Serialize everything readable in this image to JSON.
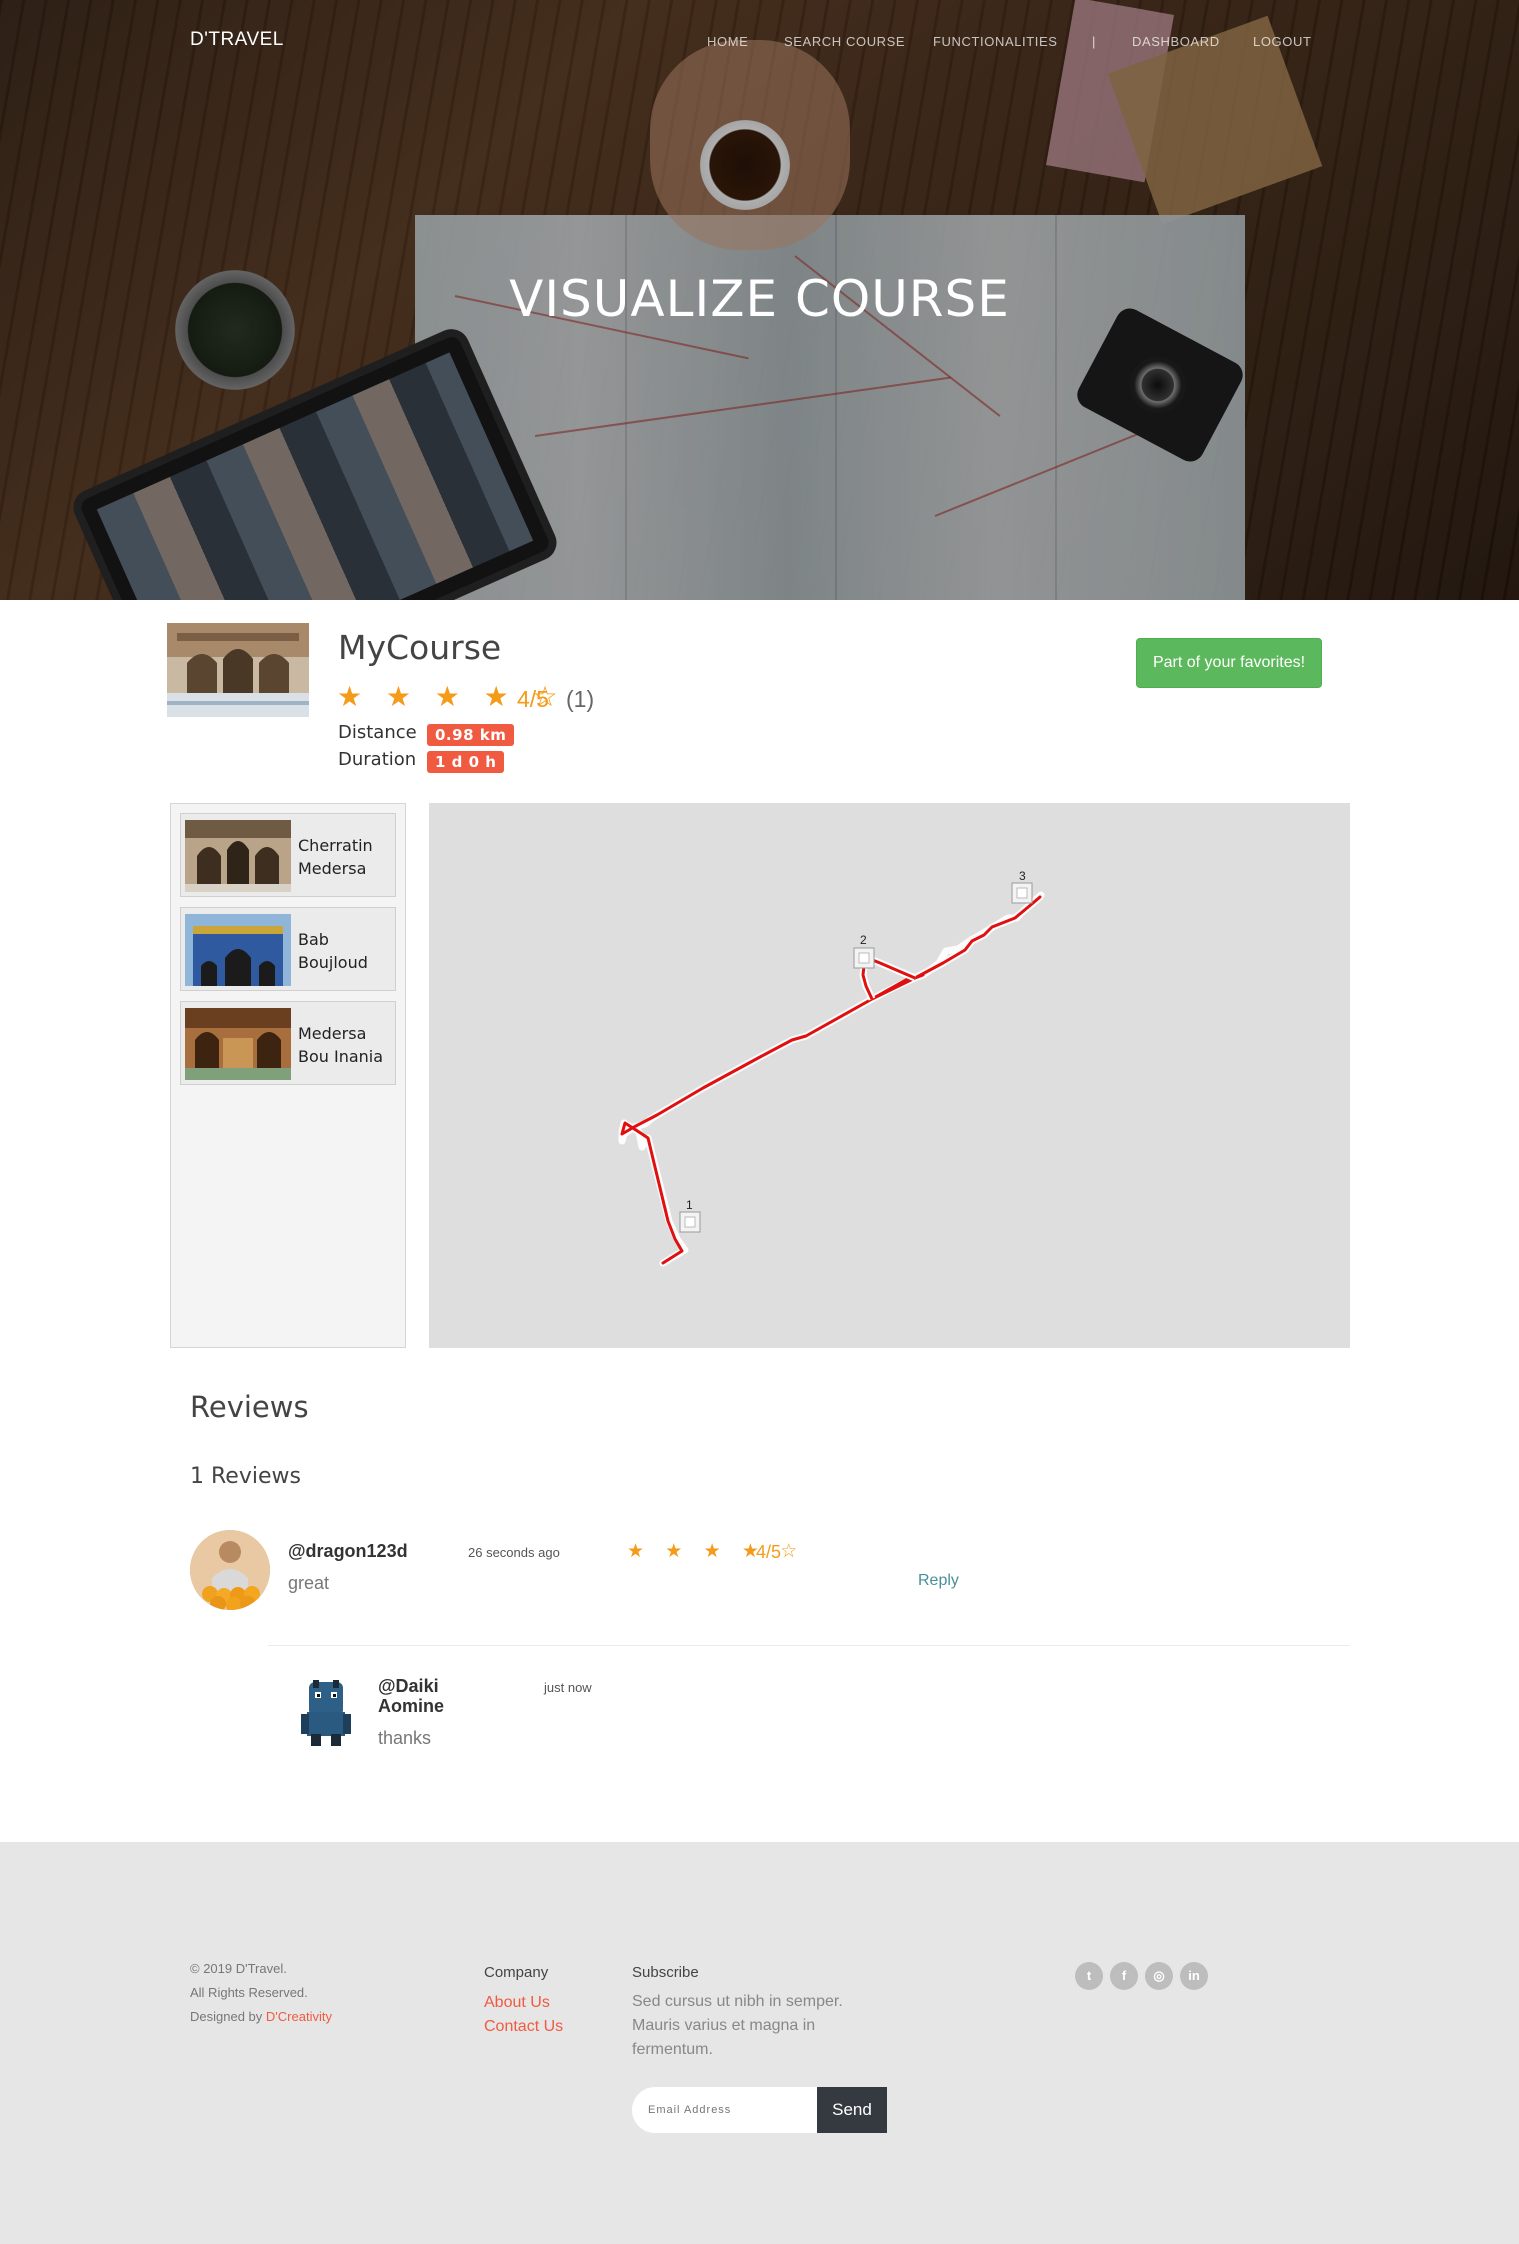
{
  "nav": {
    "brand": "D'TRAVEL",
    "items": [
      "HOME",
      "SEARCH COURSE",
      "FUNCTIONALITIES",
      "|",
      "DASHBOARD",
      "LOGOUT"
    ]
  },
  "hero": {
    "title": "VISUALIZE COURSE"
  },
  "course": {
    "name": "MyCourse",
    "stars": "★ ★ ★ ★ ☆",
    "rating": "4/5",
    "rating_count": "(1)",
    "distance_label": "Distance",
    "distance_value": "0.98 km",
    "duration_label": "Duration",
    "duration_value": "1 d 0 h",
    "favorite_button": "Part of your favorites!"
  },
  "places": [
    {
      "name": "Cherratin Medersa"
    },
    {
      "name": "Bab Boujloud"
    },
    {
      "name": "Medersa Bou Inania"
    }
  ],
  "map": {
    "markers": [
      "1",
      "2",
      "3"
    ]
  },
  "reviews": {
    "heading": "Reviews",
    "count_label": "1 Reviews",
    "items": [
      {
        "user": "@dragon123d",
        "time": "26 seconds ago",
        "stars": "★ ★ ★ ★ ☆",
        "score": "4/5",
        "text": "great",
        "reply_label": "Reply",
        "replies": [
          {
            "user_line1": "@Daiki",
            "user_line2": "Aomine",
            "time": "just now",
            "text": "thanks"
          }
        ]
      }
    ]
  },
  "footer": {
    "copyright": "© 2019 D'Travel.",
    "rights": "All Rights Reserved.",
    "designed_by": "Designed by",
    "designer": "D'Creativity",
    "company_heading": "Company",
    "links": [
      "About Us",
      "Contact Us"
    ],
    "subscribe_heading": "Subscribe",
    "subscribe_text": "Sed cursus ut nibh in semper. Mauris varius et magna in fermentum.",
    "email_placeholder": "Email Address",
    "send_label": "Send",
    "social": [
      {
        "icon": "twitter-icon",
        "glyph": "t"
      },
      {
        "icon": "facebook-icon",
        "glyph": "f"
      },
      {
        "icon": "instagram-icon",
        "glyph": "◎"
      },
      {
        "icon": "linkedin-icon",
        "glyph": "in"
      }
    ]
  },
  "colors": {
    "accent": "#f05a41",
    "star": "#f49b1a",
    "favorite": "#5cb85c",
    "route": "#e01010",
    "link": "#4a8f9a"
  }
}
